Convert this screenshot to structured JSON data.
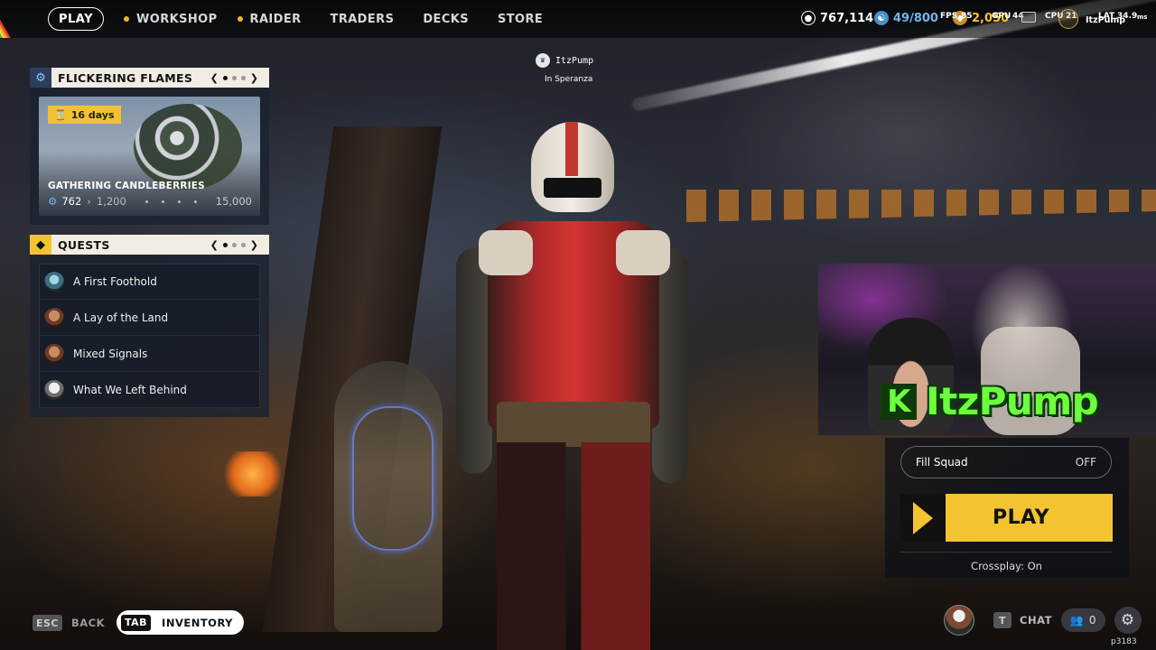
{
  "nav": {
    "play": "PLAY",
    "items": [
      {
        "label": "WORKSHOP",
        "dot": true
      },
      {
        "label": "RAIDER",
        "dot": true
      },
      {
        "label": "TRADERS",
        "dot": false
      },
      {
        "label": "DECKS",
        "dot": false
      },
      {
        "label": "STORE",
        "dot": false
      }
    ]
  },
  "currency": {
    "coins": "767,114",
    "raider_tokens": "49/800",
    "cred": "2,050"
  },
  "hud_overlay": {
    "fps_label": "FPS",
    "fps_value": "85",
    "gpu_label": "GPU",
    "gpu_value": "44",
    "cpu_label": "CPU",
    "cpu_value": "21",
    "lat_label": "LAT",
    "lat_value": "34.9",
    "lat_unit": "ms",
    "user": "ItzPump"
  },
  "event_panel": {
    "title": "FLICKERING FLAMES",
    "pager_page": 1,
    "pager_total": 3,
    "timer": "16 days",
    "event_name": "GATHERING CANDLEBERRIES",
    "progress_current": "762",
    "progress_next": "1,200",
    "progress_max": "15,000"
  },
  "quests_panel": {
    "title": "QUESTS",
    "pager_page": 1,
    "pager_total": 3,
    "items": [
      {
        "label": "A First Foothold",
        "icon": "teal"
      },
      {
        "label": "A Lay of the Land",
        "icon": "brown"
      },
      {
        "label": "Mixed Signals",
        "icon": "brown"
      },
      {
        "label": "What We Left Behind",
        "icon": "grey"
      }
    ]
  },
  "player": {
    "name": "ItzPump",
    "location": "In Speranza"
  },
  "stream_overlay": {
    "name": "ItzPump",
    "platform_glyph": "K"
  },
  "play_panel": {
    "fill_squad_label": "Fill Squad",
    "fill_squad_state": "OFF",
    "play_label": "PLAY",
    "crossplay": "Crossplay: On"
  },
  "bottom": {
    "back_key": "ESC",
    "back_label": "BACK",
    "inventory_key": "TAB",
    "inventory_label": "INVENTORY",
    "chat_key": "T",
    "chat_label": "CHAT",
    "party_count": "0",
    "build": "p3183"
  },
  "colors": {
    "accent_yellow": "#f3c331",
    "panel_header": "#f1ede2",
    "kick_green": "#6cff3c"
  }
}
